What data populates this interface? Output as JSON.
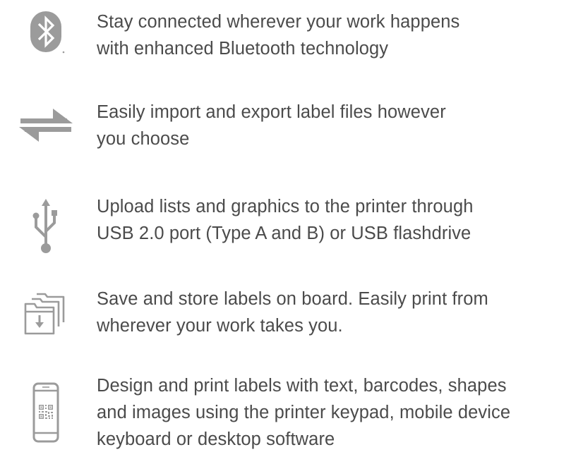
{
  "features": [
    {
      "icon": "bluetooth-icon",
      "lines": [
        "Stay connected wherever your work happens",
        "with enhanced Bluetooth technology"
      ]
    },
    {
      "icon": "transfer-arrows-icon",
      "lines": [
        "Easily import and export label files however",
        "you choose"
      ]
    },
    {
      "icon": "usb-icon",
      "lines": [
        "Upload lists and graphics to the printer through",
        "USB 2.0 port (Type A and B) or USB flashdrive"
      ]
    },
    {
      "icon": "stacked-folders-download-icon",
      "lines": [
        "Save and store labels on board. Easily print from",
        "wherever your work takes you."
      ]
    },
    {
      "icon": "smartphone-qr-code-icon",
      "lines": [
        "Design and print labels with text, barcodes, shapes",
        "and images using the printer keypad, mobile device",
        "keyboard or desktop software"
      ]
    }
  ],
  "colors": {
    "icon": "#9b9b9b",
    "text": "#4b4b4b"
  }
}
